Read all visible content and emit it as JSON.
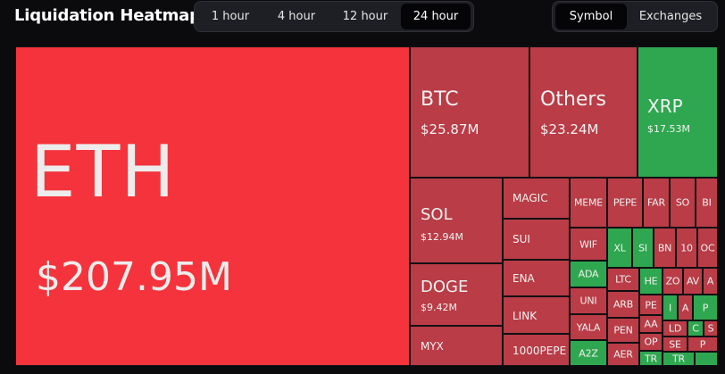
{
  "header": {
    "title": "Liquidation Heatmap",
    "time_options": [
      "1 hour",
      "4 hour",
      "12 hour",
      "24 hour"
    ],
    "time_selected": "24 hour",
    "view_options": [
      "Symbol",
      "Exchanges"
    ],
    "view_selected": "Symbol"
  },
  "colors": {
    "red_bright": "#f5333c",
    "red": "#b93c46",
    "green": "#2fa750",
    "background": "#0b0b0e"
  },
  "tiles": {
    "eth": {
      "symbol": "ETH",
      "value": "$207.95M"
    },
    "btc": {
      "symbol": "BTC",
      "value": "$25.87M"
    },
    "others": {
      "symbol": "Others",
      "value": "$23.24M"
    },
    "xrp": {
      "symbol": "XRP",
      "value": "$17.53M"
    },
    "sol": {
      "symbol": "SOL",
      "value": "$12.94M"
    },
    "doge": {
      "symbol": "DOGE",
      "value": "$9.42M"
    },
    "myx": {
      "symbol": "MYX"
    },
    "magic": {
      "symbol": "MAGIC"
    },
    "sui": {
      "symbol": "SUI"
    },
    "ena": {
      "symbol": "ENA"
    },
    "link": {
      "symbol": "LINK"
    },
    "pepe1000": {
      "symbol": "1000PEPE"
    },
    "meme": {
      "symbol": "MEME"
    },
    "pepe": {
      "symbol": "PEPE"
    },
    "far": {
      "symbol": "FAR"
    },
    "so": {
      "symbol": "SO"
    },
    "bi": {
      "symbol": "BI"
    },
    "wif": {
      "symbol": "WIF"
    },
    "ada": {
      "symbol": "ADA"
    },
    "uni": {
      "symbol": "UNI"
    },
    "yala": {
      "symbol": "YALA"
    },
    "a2z": {
      "symbol": "A2Z"
    },
    "xl": {
      "symbol": "XL"
    },
    "si": {
      "symbol": "SI"
    },
    "bn": {
      "symbol": "BN"
    },
    "n10": {
      "symbol": "10"
    },
    "oc": {
      "symbol": "OC"
    },
    "ltc": {
      "symbol": "LTC"
    },
    "he": {
      "symbol": "HE"
    },
    "zo": {
      "symbol": "ZO"
    },
    "av": {
      "symbol": "AV"
    },
    "a1": {
      "symbol": "A"
    },
    "arb": {
      "symbol": "ARB"
    },
    "pe": {
      "symbol": "PE"
    },
    "i1": {
      "symbol": "I"
    },
    "a2": {
      "symbol": "A"
    },
    "p1": {
      "symbol": "P"
    },
    "pen": {
      "symbol": "PEN"
    },
    "aa": {
      "symbol": "AA"
    },
    "ld": {
      "symbol": "LD"
    },
    "c1": {
      "symbol": "C"
    },
    "op": {
      "symbol": "OP"
    },
    "se": {
      "symbol": "SE"
    },
    "p2": {
      "symbol": "P"
    },
    "aer": {
      "symbol": "AER"
    },
    "tr1": {
      "symbol": "TR"
    },
    "tr2": {
      "symbol": "TR"
    },
    "s1": {
      "symbol": "S"
    }
  }
}
